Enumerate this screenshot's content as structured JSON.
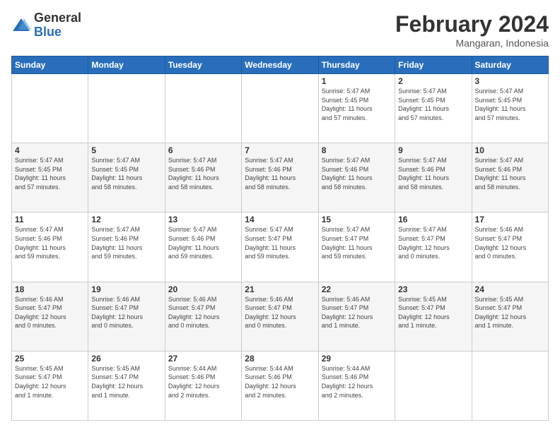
{
  "header": {
    "logo_general": "General",
    "logo_blue": "Blue",
    "title": "February 2024",
    "location": "Mangaran, Indonesia"
  },
  "days_of_week": [
    "Sunday",
    "Monday",
    "Tuesday",
    "Wednesday",
    "Thursday",
    "Friday",
    "Saturday"
  ],
  "weeks": [
    [
      {
        "num": "",
        "info": ""
      },
      {
        "num": "",
        "info": ""
      },
      {
        "num": "",
        "info": ""
      },
      {
        "num": "",
        "info": ""
      },
      {
        "num": "1",
        "info": "Sunrise: 5:47 AM\nSunset: 5:45 PM\nDaylight: 11 hours\nand 57 minutes."
      },
      {
        "num": "2",
        "info": "Sunrise: 5:47 AM\nSunset: 5:45 PM\nDaylight: 11 hours\nand 57 minutes."
      },
      {
        "num": "3",
        "info": "Sunrise: 5:47 AM\nSunset: 5:45 PM\nDaylight: 11 hours\nand 57 minutes."
      }
    ],
    [
      {
        "num": "4",
        "info": "Sunrise: 5:47 AM\nSunset: 5:45 PM\nDaylight: 11 hours\nand 57 minutes."
      },
      {
        "num": "5",
        "info": "Sunrise: 5:47 AM\nSunset: 5:45 PM\nDaylight: 11 hours\nand 58 minutes."
      },
      {
        "num": "6",
        "info": "Sunrise: 5:47 AM\nSunset: 5:46 PM\nDaylight: 11 hours\nand 58 minutes."
      },
      {
        "num": "7",
        "info": "Sunrise: 5:47 AM\nSunset: 5:46 PM\nDaylight: 11 hours\nand 58 minutes."
      },
      {
        "num": "8",
        "info": "Sunrise: 5:47 AM\nSunset: 5:46 PM\nDaylight: 11 hours\nand 58 minutes."
      },
      {
        "num": "9",
        "info": "Sunrise: 5:47 AM\nSunset: 5:46 PM\nDaylight: 11 hours\nand 58 minutes."
      },
      {
        "num": "10",
        "info": "Sunrise: 5:47 AM\nSunset: 5:46 PM\nDaylight: 11 hours\nand 58 minutes."
      }
    ],
    [
      {
        "num": "11",
        "info": "Sunrise: 5:47 AM\nSunset: 5:46 PM\nDaylight: 11 hours\nand 59 minutes."
      },
      {
        "num": "12",
        "info": "Sunrise: 5:47 AM\nSunset: 5:46 PM\nDaylight: 11 hours\nand 59 minutes."
      },
      {
        "num": "13",
        "info": "Sunrise: 5:47 AM\nSunset: 5:46 PM\nDaylight: 11 hours\nand 59 minutes."
      },
      {
        "num": "14",
        "info": "Sunrise: 5:47 AM\nSunset: 5:47 PM\nDaylight: 11 hours\nand 59 minutes."
      },
      {
        "num": "15",
        "info": "Sunrise: 5:47 AM\nSunset: 5:47 PM\nDaylight: 11 hours\nand 59 minutes."
      },
      {
        "num": "16",
        "info": "Sunrise: 5:47 AM\nSunset: 5:47 PM\nDaylight: 12 hours\nand 0 minutes."
      },
      {
        "num": "17",
        "info": "Sunrise: 5:46 AM\nSunset: 5:47 PM\nDaylight: 12 hours\nand 0 minutes."
      }
    ],
    [
      {
        "num": "18",
        "info": "Sunrise: 5:46 AM\nSunset: 5:47 PM\nDaylight: 12 hours\nand 0 minutes."
      },
      {
        "num": "19",
        "info": "Sunrise: 5:46 AM\nSunset: 5:47 PM\nDaylight: 12 hours\nand 0 minutes."
      },
      {
        "num": "20",
        "info": "Sunrise: 5:46 AM\nSunset: 5:47 PM\nDaylight: 12 hours\nand 0 minutes."
      },
      {
        "num": "21",
        "info": "Sunrise: 5:46 AM\nSunset: 5:47 PM\nDaylight: 12 hours\nand 0 minutes."
      },
      {
        "num": "22",
        "info": "Sunrise: 5:46 AM\nSunset: 5:47 PM\nDaylight: 12 hours\nand 1 minute."
      },
      {
        "num": "23",
        "info": "Sunrise: 5:45 AM\nSunset: 5:47 PM\nDaylight: 12 hours\nand 1 minute."
      },
      {
        "num": "24",
        "info": "Sunrise: 5:45 AM\nSunset: 5:47 PM\nDaylight: 12 hours\nand 1 minute."
      }
    ],
    [
      {
        "num": "25",
        "info": "Sunrise: 5:45 AM\nSunset: 5:47 PM\nDaylight: 12 hours\nand 1 minute."
      },
      {
        "num": "26",
        "info": "Sunrise: 5:45 AM\nSunset: 5:47 PM\nDaylight: 12 hours\nand 1 minute."
      },
      {
        "num": "27",
        "info": "Sunrise: 5:44 AM\nSunset: 5:46 PM\nDaylight: 12 hours\nand 2 minutes."
      },
      {
        "num": "28",
        "info": "Sunrise: 5:44 AM\nSunset: 5:46 PM\nDaylight: 12 hours\nand 2 minutes."
      },
      {
        "num": "29",
        "info": "Sunrise: 5:44 AM\nSunset: 5:46 PM\nDaylight: 12 hours\nand 2 minutes."
      },
      {
        "num": "",
        "info": ""
      },
      {
        "num": "",
        "info": ""
      }
    ]
  ]
}
